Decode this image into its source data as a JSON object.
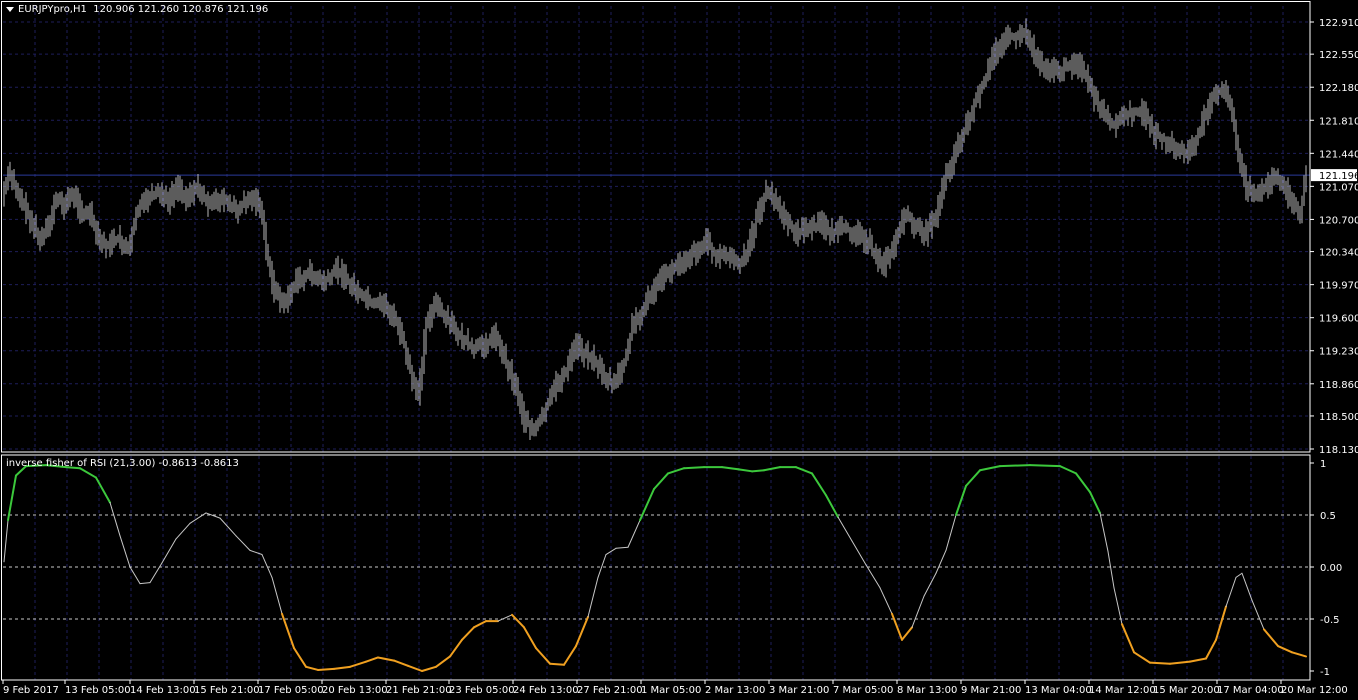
{
  "window": {
    "symbol": "EURJPYpro,H1",
    "ohlc": "120.906 121.260 120.876 121.196"
  },
  "indicator": {
    "label": "inverse fisher of RSI (21,3.00) -0.8613 -0.8613"
  },
  "colors": {
    "background": "#000000",
    "grid": "#1e1e5a",
    "bars": "#b8b8b8",
    "separator": "#ffffff",
    "current_price_line": "#2a3a9a",
    "indicator_up": "#3cc83c",
    "indicator_mid": "#c8c8c8",
    "indicator_down": "#f0a020"
  },
  "price_axis": {
    "ticks": [
      "122.910",
      "122.550",
      "122.180",
      "121.810",
      "121.440",
      "121.070",
      "120.700",
      "120.340",
      "119.970",
      "119.600",
      "119.230",
      "118.860",
      "118.500",
      "118.130"
    ],
    "current_price": "121.196"
  },
  "indicator_axis": {
    "ticks": [
      "1",
      "0.5",
      "0.00",
      "-0.5",
      "-1"
    ]
  },
  "time_axis": {
    "labels": [
      "9 Feb 2017",
      "13 Feb 05:00",
      "14 Feb 13:00",
      "15 Feb 21:00",
      "17 Feb 05:00",
      "20 Feb 13:00",
      "21 Feb 21:00",
      "23 Feb 05:00",
      "24 Feb 13:00",
      "27 Feb 21:00",
      "1 Mar 05:00",
      "2 Mar 13:00",
      "3 Mar 21:00",
      "7 Mar 05:00",
      "8 Mar 13:00",
      "9 Mar 21:00",
      "13 Mar 04:00",
      "14 Mar 12:00",
      "15 Mar 20:00",
      "17 Mar 04:00",
      "20 Mar 12:00"
    ]
  },
  "chart_data": {
    "type": "line",
    "price_ylim": [
      118.06,
      123.02
    ],
    "price_path": [
      [
        0,
        120.85
      ],
      [
        8,
        121.2
      ],
      [
        14,
        121.1
      ],
      [
        22,
        120.9
      ],
      [
        30,
        120.7
      ],
      [
        40,
        120.45
      ],
      [
        48,
        120.6
      ],
      [
        56,
        120.95
      ],
      [
        64,
        120.85
      ],
      [
        72,
        121.0
      ],
      [
        80,
        120.8
      ],
      [
        90,
        120.75
      ],
      [
        98,
        120.45
      ],
      [
        108,
        120.4
      ],
      [
        118,
        120.5
      ],
      [
        128,
        120.35
      ],
      [
        136,
        120.8
      ],
      [
        146,
        120.9
      ],
      [
        156,
        121.0
      ],
      [
        168,
        120.9
      ],
      [
        176,
        121.05
      ],
      [
        186,
        120.95
      ],
      [
        198,
        121.05
      ],
      [
        210,
        120.85
      ],
      [
        222,
        120.95
      ],
      [
        236,
        120.8
      ],
      [
        248,
        120.95
      ],
      [
        260,
        120.85
      ],
      [
        266,
        120.35
      ],
      [
        274,
        119.9
      ],
      [
        284,
        119.75
      ],
      [
        296,
        120.0
      ],
      [
        310,
        120.1
      ],
      [
        324,
        120.0
      ],
      [
        336,
        120.15
      ],
      [
        348,
        120.0
      ],
      [
        360,
        119.85
      ],
      [
        372,
        119.75
      ],
      [
        384,
        119.75
      ],
      [
        396,
        119.55
      ],
      [
        404,
        119.3
      ],
      [
        412,
        118.9
      ],
      [
        418,
        118.7
      ],
      [
        426,
        119.55
      ],
      [
        436,
        119.75
      ],
      [
        448,
        119.55
      ],
      [
        460,
        119.4
      ],
      [
        472,
        119.25
      ],
      [
        484,
        119.3
      ],
      [
        496,
        119.4
      ],
      [
        506,
        119.1
      ],
      [
        516,
        118.8
      ],
      [
        524,
        118.45
      ],
      [
        534,
        118.35
      ],
      [
        544,
        118.55
      ],
      [
        556,
        118.85
      ],
      [
        566,
        119.0
      ],
      [
        576,
        119.3
      ],
      [
        584,
        119.2
      ],
      [
        592,
        119.15
      ],
      [
        604,
        118.95
      ],
      [
        614,
        118.85
      ],
      [
        624,
        119.1
      ],
      [
        632,
        119.5
      ],
      [
        640,
        119.65
      ],
      [
        650,
        119.85
      ],
      [
        660,
        120.0
      ],
      [
        672,
        120.15
      ],
      [
        684,
        120.25
      ],
      [
        696,
        120.35
      ],
      [
        706,
        120.45
      ],
      [
        716,
        120.3
      ],
      [
        728,
        120.3
      ],
      [
        740,
        120.2
      ],
      [
        748,
        120.35
      ],
      [
        756,
        120.7
      ],
      [
        766,
        121.0
      ],
      [
        774,
        120.95
      ],
      [
        784,
        120.7
      ],
      [
        796,
        120.55
      ],
      [
        808,
        120.6
      ],
      [
        820,
        120.65
      ],
      [
        832,
        120.55
      ],
      [
        844,
        120.6
      ],
      [
        856,
        120.55
      ],
      [
        868,
        120.45
      ],
      [
        876,
        120.25
      ],
      [
        884,
        120.2
      ],
      [
        892,
        120.35
      ],
      [
        900,
        120.65
      ],
      [
        908,
        120.75
      ],
      [
        916,
        120.6
      ],
      [
        926,
        120.55
      ],
      [
        936,
        120.75
      ],
      [
        944,
        121.15
      ],
      [
        952,
        121.35
      ],
      [
        960,
        121.6
      ],
      [
        968,
        121.8
      ],
      [
        976,
        122.05
      ],
      [
        986,
        122.3
      ],
      [
        996,
        122.6
      ],
      [
        1006,
        122.75
      ],
      [
        1016,
        122.75
      ],
      [
        1026,
        122.8
      ],
      [
        1036,
        122.5
      ],
      [
        1046,
        122.4
      ],
      [
        1056,
        122.35
      ],
      [
        1066,
        122.4
      ],
      [
        1076,
        122.45
      ],
      [
        1086,
        122.3
      ],
      [
        1094,
        122.05
      ],
      [
        1102,
        121.9
      ],
      [
        1112,
        121.75
      ],
      [
        1122,
        121.85
      ],
      [
        1132,
        121.9
      ],
      [
        1144,
        121.9
      ],
      [
        1154,
        121.65
      ],
      [
        1164,
        121.6
      ],
      [
        1174,
        121.5
      ],
      [
        1184,
        121.45
      ],
      [
        1194,
        121.5
      ],
      [
        1204,
        121.85
      ],
      [
        1212,
        122.1
      ],
      [
        1222,
        122.15
      ],
      [
        1230,
        122.0
      ],
      [
        1238,
        121.45
      ],
      [
        1246,
        121.05
      ],
      [
        1256,
        120.95
      ],
      [
        1264,
        121.05
      ],
      [
        1274,
        121.2
      ],
      [
        1282,
        121.1
      ],
      [
        1292,
        120.9
      ],
      [
        1300,
        120.75
      ],
      [
        1306,
        121.2
      ]
    ],
    "indicator_path": [
      [
        4,
        0.05
      ],
      [
        8,
        0.45
      ],
      [
        16,
        0.88
      ],
      [
        26,
        0.97
      ],
      [
        46,
        0.98
      ],
      [
        66,
        0.96
      ],
      [
        80,
        0.95
      ],
      [
        96,
        0.86
      ],
      [
        110,
        0.62
      ],
      [
        120,
        0.3
      ],
      [
        130,
        0.0
      ],
      [
        140,
        -0.16
      ],
      [
        150,
        -0.15
      ],
      [
        162,
        0.04
      ],
      [
        176,
        0.27
      ],
      [
        190,
        0.42
      ],
      [
        206,
        0.52
      ],
      [
        220,
        0.47
      ],
      [
        236,
        0.3
      ],
      [
        250,
        0.16
      ],
      [
        262,
        0.12
      ],
      [
        272,
        -0.1
      ],
      [
        282,
        -0.45
      ],
      [
        294,
        -0.78
      ],
      [
        306,
        -0.96
      ],
      [
        318,
        -0.99
      ],
      [
        334,
        -0.98
      ],
      [
        350,
        -0.96
      ],
      [
        366,
        -0.91
      ],
      [
        378,
        -0.87
      ],
      [
        394,
        -0.9
      ],
      [
        408,
        -0.95
      ],
      [
        422,
        -1.0
      ],
      [
        436,
        -0.96
      ],
      [
        450,
        -0.86
      ],
      [
        462,
        -0.7
      ],
      [
        474,
        -0.58
      ],
      [
        486,
        -0.52
      ],
      [
        498,
        -0.52
      ],
      [
        512,
        -0.46
      ],
      [
        524,
        -0.58
      ],
      [
        536,
        -0.78
      ],
      [
        550,
        -0.93
      ],
      [
        564,
        -0.94
      ],
      [
        576,
        -0.76
      ],
      [
        588,
        -0.48
      ],
      [
        598,
        -0.1
      ],
      [
        606,
        0.12
      ],
      [
        616,
        0.18
      ],
      [
        628,
        0.19
      ],
      [
        640,
        0.45
      ],
      [
        654,
        0.75
      ],
      [
        668,
        0.9
      ],
      [
        684,
        0.95
      ],
      [
        704,
        0.96
      ],
      [
        722,
        0.96
      ],
      [
        738,
        0.94
      ],
      [
        752,
        0.92
      ],
      [
        764,
        0.93
      ],
      [
        780,
        0.96
      ],
      [
        796,
        0.96
      ],
      [
        812,
        0.9
      ],
      [
        826,
        0.69
      ],
      [
        838,
        0.48
      ],
      [
        852,
        0.25
      ],
      [
        866,
        0.02
      ],
      [
        880,
        -0.2
      ],
      [
        892,
        -0.45
      ],
      [
        902,
        -0.7
      ],
      [
        912,
        -0.58
      ],
      [
        924,
        -0.28
      ],
      [
        936,
        -0.06
      ],
      [
        946,
        0.16
      ],
      [
        956,
        0.5
      ],
      [
        966,
        0.78
      ],
      [
        980,
        0.93
      ],
      [
        1000,
        0.97
      ],
      [
        1030,
        0.98
      ],
      [
        1060,
        0.97
      ],
      [
        1076,
        0.9
      ],
      [
        1090,
        0.72
      ],
      [
        1100,
        0.52
      ],
      [
        1108,
        0.15
      ],
      [
        1114,
        -0.2
      ],
      [
        1122,
        -0.55
      ],
      [
        1134,
        -0.82
      ],
      [
        1150,
        -0.92
      ],
      [
        1170,
        -0.93
      ],
      [
        1190,
        -0.91
      ],
      [
        1206,
        -0.88
      ],
      [
        1216,
        -0.7
      ],
      [
        1226,
        -0.38
      ],
      [
        1236,
        -0.1
      ],
      [
        1242,
        -0.06
      ],
      [
        1252,
        -0.32
      ],
      [
        1264,
        -0.6
      ],
      [
        1278,
        -0.76
      ],
      [
        1292,
        -0.82
      ],
      [
        1306,
        -0.86
      ]
    ]
  }
}
